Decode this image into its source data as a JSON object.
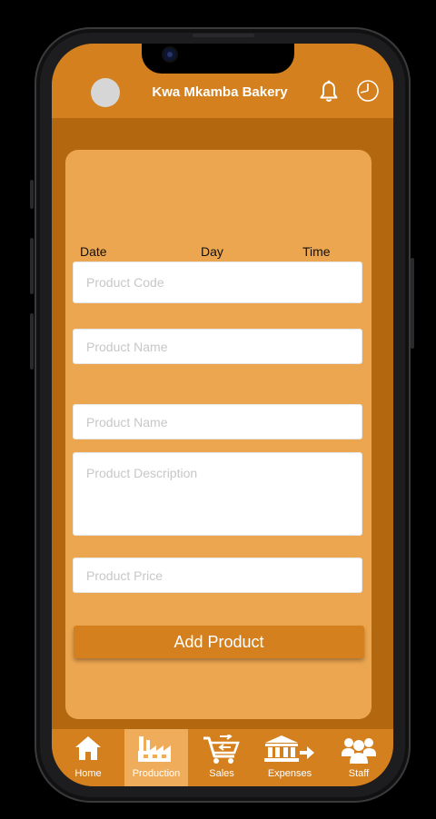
{
  "header": {
    "title": "Kwa Mkamba Bakery",
    "notification_icon": "bell-icon",
    "history_icon": "history-icon"
  },
  "form": {
    "date_label": "Date",
    "day_label": "Day",
    "time_label": "Time",
    "product_code_placeholder": "Product Code",
    "product_name_placeholder": "Product Name",
    "product_name2_placeholder": "Product Name",
    "product_description_placeholder": "Product Description",
    "product_price_placeholder": "Product Price",
    "submit_label": "Add Product"
  },
  "nav": {
    "items": [
      {
        "label": "Home",
        "icon": "home-icon"
      },
      {
        "label": "Production",
        "icon": "factory-icon",
        "active": true
      },
      {
        "label": "Sales",
        "icon": "cart-icon"
      },
      {
        "label": "Expenses",
        "icon": "bank-icon"
      },
      {
        "label": "Staff",
        "icon": "people-icon"
      }
    ]
  },
  "colors": {
    "header": "#d4801e",
    "screen_bg": "#b3670f",
    "card": "#eda650",
    "nav_active": "#efad5c"
  }
}
